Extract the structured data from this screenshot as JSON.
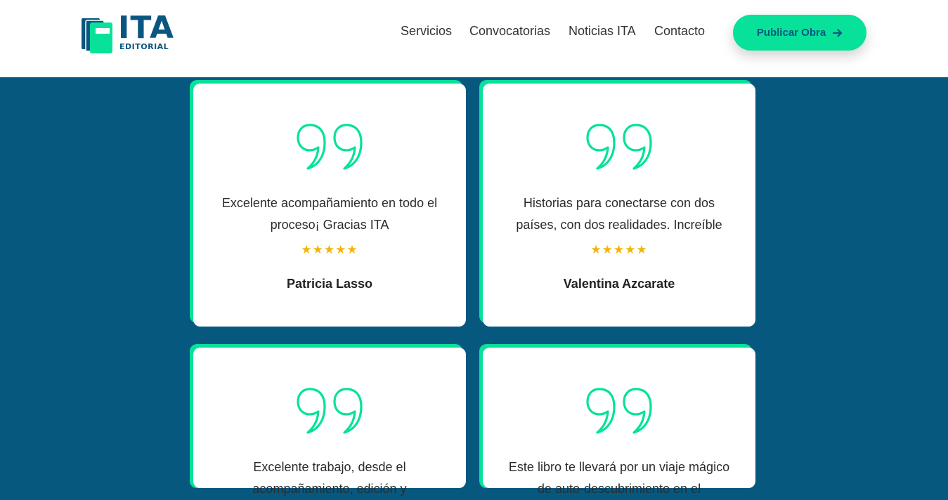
{
  "header": {
    "logo": {
      "title": "ITA",
      "subtitle": "EDITORIAL",
      "icon": "books-icon"
    },
    "nav": [
      {
        "label": "Servicios"
      },
      {
        "label": "Convocatorias"
      },
      {
        "label": "Noticias ITA"
      },
      {
        "label": "Contacto"
      }
    ],
    "cta": {
      "label": "Publicar Obra",
      "icon": "arrow-right-icon"
    }
  },
  "colors": {
    "accent": "#07e19a",
    "brand_blue": "#0a5680",
    "section_bg": "#07587f",
    "star": "#f4b400"
  },
  "testimonials": [
    {
      "quote": "Excelente acompañamiento en todo el proceso¡ Gracias ITA",
      "stars": "★★★★★",
      "rating": 5,
      "author": "Patricia Lasso"
    },
    {
      "quote": "Historias para conectarse con dos países, con dos realidades. Increíble",
      "stars": "★★★★★",
      "rating": 5,
      "author": "Valentina Azcarate"
    },
    {
      "quote": "Excelente trabajo, desde el acompañamiento, edición y",
      "stars": "",
      "author": ""
    },
    {
      "quote": "Este libro te llevará por un viaje mágico de auto-descubrimiento en el",
      "stars": "",
      "author": ""
    }
  ]
}
